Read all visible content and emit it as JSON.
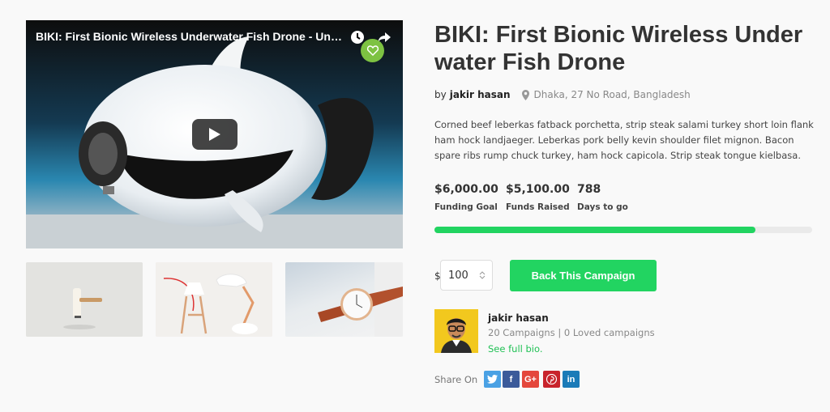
{
  "video": {
    "title": "BIKI: First Bionic Wireless Underwater Fish Drone - Under..."
  },
  "campaign": {
    "title": "BIKI: First Bionic Wireless Under water Fish Drone",
    "by_label": "by",
    "author": "jakir hasan",
    "location": "Dhaka, 27 No Road, Bangladesh",
    "description": "Corned beef leberkas fatback porchetta, strip steak salami turkey short loin flank ham hock landjaeger. Leberkas pork belly kevin shoulder filet mignon. Bacon spare ribs rump chuck turkey, ham hock capicola. Strip steak tongue kielbasa."
  },
  "stats": [
    {
      "value": "$6,000.00",
      "label": "Funding Goal"
    },
    {
      "value": "$5,100.00",
      "label": "Funds Raised"
    },
    {
      "value": "788",
      "label": "Days to go"
    }
  ],
  "progress": {
    "percent": 85,
    "color": "#22d461"
  },
  "pledge": {
    "currency": "$",
    "amount": "100",
    "button_label": "Back This Campaign"
  },
  "creator": {
    "name": "jakir hasan",
    "stats": "20 Campaigns | 0 Loved campaigns",
    "bio_link": "See full bio."
  },
  "share": {
    "label": "Share On",
    "networks": [
      {
        "name": "twitter-icon",
        "glyph": "t"
      },
      {
        "name": "facebook-icon",
        "glyph": "f"
      },
      {
        "name": "google-plus-icon",
        "glyph": "G+"
      },
      {
        "name": "pinterest-icon",
        "glyph": "p"
      },
      {
        "name": "linkedin-icon",
        "glyph": "in"
      }
    ]
  },
  "colors": {
    "accent": "#22d461",
    "heart": "#7dc242",
    "twitter": "#4aa1e4",
    "facebook": "#3b5a9a",
    "google_plus": "#e4473c",
    "pinterest": "#c8232c",
    "linkedin": "#1b7bb8"
  }
}
